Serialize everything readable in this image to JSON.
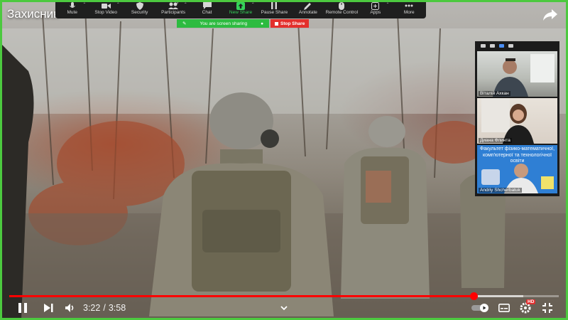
{
  "video": {
    "title": "Захисник",
    "current_time": "3:22",
    "separator": "/",
    "duration": "3:58",
    "progress_fraction": 0.845,
    "buffer_fraction": 0.935,
    "quality_badge": "HD"
  },
  "toolbar": {
    "items": [
      {
        "label": "Mute",
        "icon": "mic-icon"
      },
      {
        "label": "Stop Video",
        "icon": "video-camera-icon"
      },
      {
        "label": "Security",
        "icon": "shield-icon"
      },
      {
        "label": "Participants",
        "icon": "participants-icon",
        "count": "3"
      },
      {
        "label": "Chat",
        "icon": "chat-icon"
      },
      {
        "label": "New Share",
        "icon": "share-up-arrow-icon"
      },
      {
        "label": "Pause Share",
        "icon": "pause-icon"
      },
      {
        "label": "Annotate",
        "icon": "pencil-icon"
      },
      {
        "label": "Remote Control",
        "icon": "mouse-icon"
      },
      {
        "label": "Apps",
        "icon": "apps-icon"
      },
      {
        "label": "More",
        "icon": "more-dots-icon"
      }
    ]
  },
  "share_bar": {
    "sharing_text": "You are screen sharing",
    "stop_label": "Stop Share"
  },
  "participants": [
    {
      "name": "Віталій Ахкан"
    },
    {
      "name": "Диана Флинта"
    },
    {
      "name": "Andriy Shcherbatuk",
      "slide_text": "Факультет фізико-математичної, комп'ютерної та технологічної освіти"
    }
  ],
  "colors": {
    "accent_green": "#4cc93f",
    "stop_red": "#e3302c",
    "progress_red": "#ff0000",
    "toolbar_bg": "#1f1f1f"
  }
}
